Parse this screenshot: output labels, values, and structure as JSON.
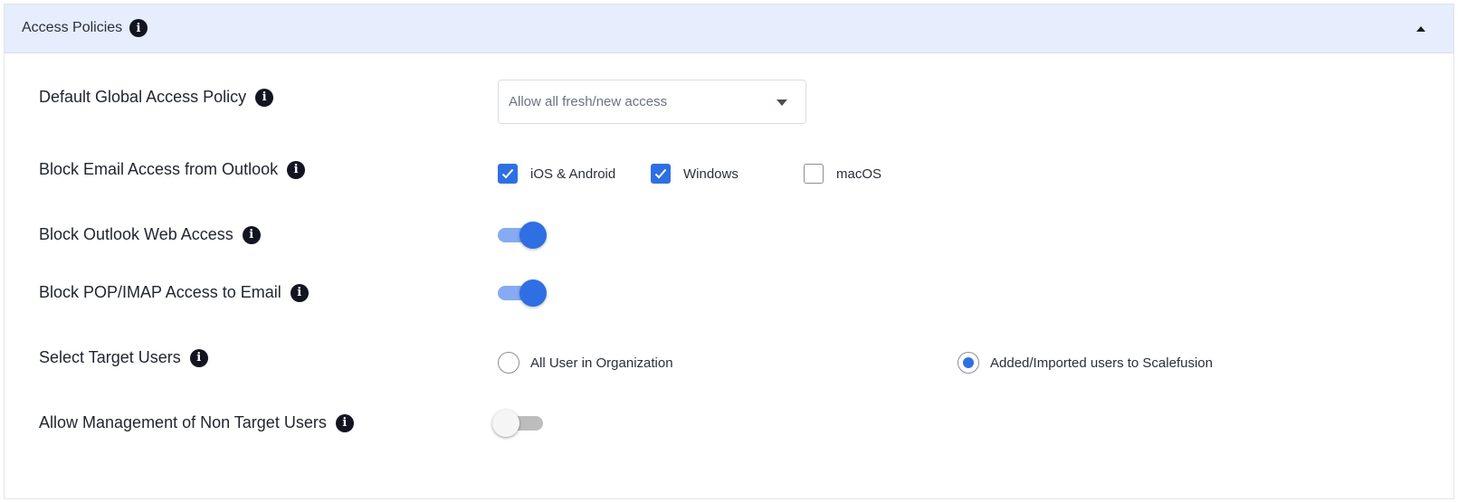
{
  "panel": {
    "title": "Access Policies",
    "collapse_icon": "caret-up-icon"
  },
  "info_icon_glyph": "i",
  "rows": {
    "default_policy": {
      "label": "Default Global Access Policy",
      "select_value": "Allow all fresh/new access"
    },
    "block_email_outlook": {
      "label": "Block Email Access from Outlook",
      "options": [
        {
          "label": "iOS & Android",
          "checked": true
        },
        {
          "label": "Windows",
          "checked": true
        },
        {
          "label": "macOS",
          "checked": false
        }
      ]
    },
    "block_outlook_web": {
      "label": "Block Outlook Web Access",
      "enabled": true
    },
    "block_pop_imap": {
      "label": "Block POP/IMAP Access to Email",
      "enabled": true
    },
    "target_users": {
      "label": "Select Target Users",
      "options": [
        {
          "label": "All User in Organization",
          "selected": false
        },
        {
          "label": "Added/Imported users to Scalefusion",
          "selected": true
        }
      ]
    },
    "non_target_mgmt": {
      "label": "Allow Management of Non Target Users",
      "enabled": false
    }
  },
  "colors": {
    "accent": "#2f6fe4",
    "header_bg": "#e6edfd"
  }
}
